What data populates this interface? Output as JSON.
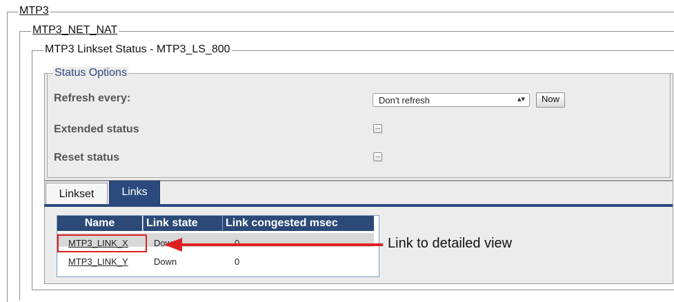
{
  "frames": {
    "level1": "MTP3",
    "level2": "MTP3_NET_NAT",
    "level3": "MTP3 Linkset Status - MTP3_LS_800"
  },
  "status_options": {
    "legend": "Status Options",
    "refresh_label": "Refresh every:",
    "refresh_selected": "Don't refresh",
    "now_button": "Now",
    "extended_label": "Extended status",
    "extended_checked": false,
    "reset_label": "Reset status",
    "reset_checked": false
  },
  "tabs": [
    {
      "label": "Linkset",
      "active": false
    },
    {
      "label": "Links",
      "active": true
    }
  ],
  "table": {
    "headers": [
      "Name",
      "Link state",
      "Link congested msec"
    ],
    "rows": [
      {
        "name": "MTP3_LINK_X",
        "state": "Down",
        "congested": "0",
        "highlighted": true
      },
      {
        "name": "MTP3_LINK_Y",
        "state": "Down",
        "congested": "0",
        "highlighted": false
      }
    ]
  },
  "annotation": {
    "text": "Link to detailed view",
    "color": "#e02020"
  },
  "colors": {
    "tab_active": "#2a4a7d",
    "header_bg": "#2c4a78"
  }
}
